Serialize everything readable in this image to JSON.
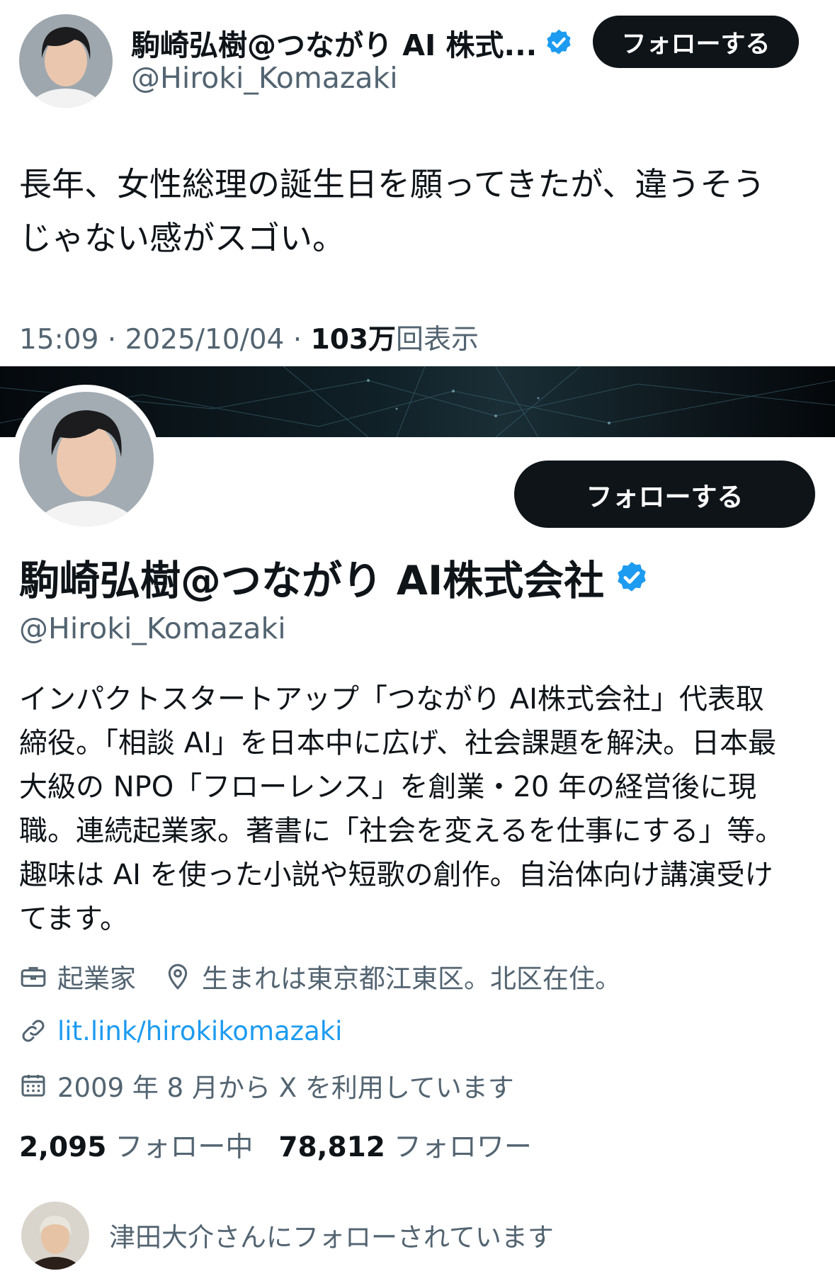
{
  "tweet": {
    "author_name": "駒崎弘樹@つながり AI 株式...",
    "author_handle": "@Hiroki_Komazaki",
    "follow_label": "フォローする",
    "text_line1": "長年、女性総理の誕生日を願ってきたが、違うそう",
    "text_line2": "じゃない感がスゴい。",
    "time": "15:09 · 2025/10/04 · ",
    "views": "103万",
    "views_label": "回表示"
  },
  "profile": {
    "name": "駒崎弘樹@つながり AI株式会社",
    "handle": "@Hiroki_Komazaki",
    "follow_label": "フォローする",
    "bio_lines": [
      "インパクトスタートアップ「つながり AI株式会社」代表取",
      "締役。「相談 AI」を日本中に広げ、社会課題を解決。日本最",
      "大級の NPO「フローレンス」を創業・20 年の経営後に現",
      "職。連続起業家。著書に「社会を変えるを仕事にする」等。",
      "趣味は AI を使った小説や短歌の創作。自治体向け講演受け",
      "てます。"
    ],
    "job": "起業家",
    "location": "生まれは東京都江東区。北区在住。",
    "link": "lit.link/hirokikomazaki",
    "joined": "2009 年 8 月から X を利用しています",
    "following_count": "2,095",
    "following_label": "フォロー中",
    "followers_count": "78,812",
    "followers_label": "フォロワー",
    "followed_by": "津田大介さんにフォローされています"
  },
  "colors": {
    "verified": "#1d9bf0",
    "link": "#1d9bf0",
    "secondary_text": "#536471",
    "button_bg": "#0f1419"
  },
  "icons": [
    "verified-badge-icon",
    "briefcase-icon",
    "location-pin-icon",
    "link-icon",
    "calendar-icon"
  ]
}
